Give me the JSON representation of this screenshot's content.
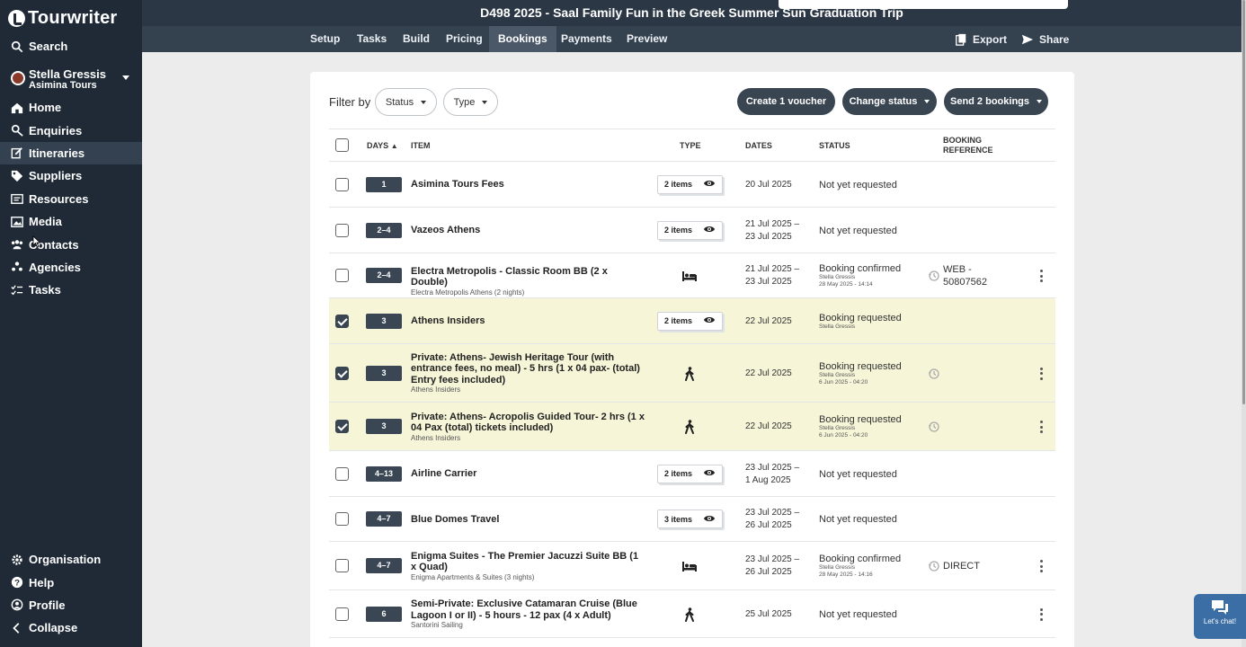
{
  "app": {
    "logo_text": "Tourwriter"
  },
  "sidebar": {
    "search_label": "Search",
    "user": {
      "name": "Stella Gressis",
      "company": "Asimina Tours"
    },
    "nav": [
      {
        "label": "Home",
        "icon": "home-icon"
      },
      {
        "label": "Enquiries",
        "icon": "enquiries-icon"
      },
      {
        "label": "Itineraries",
        "icon": "itineraries-icon",
        "active": true
      },
      {
        "label": "Suppliers",
        "icon": "tag-icon"
      },
      {
        "label": "Resources",
        "icon": "resources-icon"
      },
      {
        "label": "Media",
        "icon": "image-icon"
      },
      {
        "label": "Contacts",
        "icon": "contacts-icon"
      },
      {
        "label": "Agencies",
        "icon": "agencies-icon"
      },
      {
        "label": "Tasks",
        "icon": "tasks-icon"
      }
    ],
    "bottom": [
      {
        "label": "Organisation",
        "icon": "gear-icon"
      },
      {
        "label": "Help",
        "icon": "help-icon"
      },
      {
        "label": "Profile",
        "icon": "profile-icon"
      },
      {
        "label": "Collapse",
        "icon": "chevron-left-icon"
      }
    ]
  },
  "header": {
    "title": "D498 2025 - Saal Family Fun in the Greek Summer Sun Graduation Trip",
    "tabs": [
      "Setup",
      "Tasks",
      "Build",
      "Pricing",
      "Bookings",
      "Payments",
      "Preview"
    ],
    "active_tab": "Bookings",
    "export_label": "Export",
    "share_label": "Share"
  },
  "toolbar": {
    "filter_label": "Filter by",
    "status_filter": "Status",
    "type_filter": "Type",
    "voucher_button": "Create 1 voucher",
    "change_status_button": "Change status",
    "send_button": "Send 2 bookings"
  },
  "table": {
    "columns": {
      "days": "DAYS",
      "item": "ITEM",
      "type": "TYPE",
      "dates": "DATES",
      "status": "STATUS",
      "ref_line1": "BOOKING",
      "ref_line2": "REFERENCE"
    },
    "rows": [
      {
        "days": "1",
        "item": "Asimina Tours Fees",
        "sub": "",
        "type": "items",
        "items_label": "2 items",
        "date1": "20 Jul 2025",
        "date2": "",
        "status": "Not yet requested",
        "status_by": "",
        "status_at": "",
        "ref1": "",
        "ref2": "",
        "checked": false
      },
      {
        "days": "2–4",
        "item": "Vazeos Athens",
        "sub": "",
        "type": "items",
        "items_label": "2 items",
        "date1": "21 Jul 2025 –",
        "date2": "23 Jul 2025",
        "status": "Not yet requested",
        "status_by": "",
        "status_at": "",
        "ref1": "",
        "ref2": "",
        "checked": false
      },
      {
        "days": "2–4",
        "item": "Electra Metropolis - Classic Room BB (2 x Double)",
        "sub": "Electra Metropolis Athens (2 nights)",
        "type": "bed",
        "items_label": "",
        "date1": "21 Jul 2025 –",
        "date2": "23 Jul 2025",
        "status": "Booking confirmed",
        "status_by": "Stella Gressis",
        "status_at": "28 May 2025 - 14:14",
        "ref1": "WEB -",
        "ref2": "50807562",
        "checked": false
      },
      {
        "days": "3",
        "item": "Athens Insiders",
        "sub": "",
        "type": "items",
        "items_label": "2 items",
        "date1": "22 Jul 2025",
        "date2": "",
        "status": "Booking requested",
        "status_by": "Stella Gressis",
        "status_at": "",
        "ref1": "",
        "ref2": "",
        "checked": true
      },
      {
        "days": "3",
        "item": "Private: Athens- Jewish Heritage Tour (with entrance fees, no meal) - 5 hrs (1 x 04 pax- (total) Entry fees included)",
        "sub": "Athens Insiders",
        "type": "walk",
        "items_label": "",
        "date1": "22 Jul 2025",
        "date2": "",
        "status": "Booking requested",
        "status_by": "Stella Gressis",
        "status_at": "6 Jun 2025 - 04:20",
        "ref1": "",
        "ref2": "",
        "checked": true
      },
      {
        "days": "3",
        "item": "Private: Athens- Acropolis Guided Tour- 2 hrs (1 x 04 Pax (total) tickets included)",
        "sub": "Athens Insiders",
        "type": "walk",
        "items_label": "",
        "date1": "22 Jul 2025",
        "date2": "",
        "status": "Booking requested",
        "status_by": "Stella Gressis",
        "status_at": "6 Jun 2025 - 04:20",
        "ref1": "",
        "ref2": "",
        "checked": true
      },
      {
        "days": "4–13",
        "item": "Airline Carrier",
        "sub": "",
        "type": "items",
        "items_label": "2 items",
        "date1": "23 Jul 2025 –",
        "date2": "1 Aug 2025",
        "status": "Not yet requested",
        "status_by": "",
        "status_at": "",
        "ref1": "",
        "ref2": "",
        "checked": false
      },
      {
        "days": "4–7",
        "item": "Blue Domes Travel",
        "sub": "",
        "type": "items",
        "items_label": "3 items",
        "date1": "23 Jul 2025 –",
        "date2": "26 Jul 2025",
        "status": "Not yet requested",
        "status_by": "",
        "status_at": "",
        "ref1": "",
        "ref2": "",
        "checked": false
      },
      {
        "days": "4–7",
        "item": "Enigma Suites - The Premier Jacuzzi Suite BB (1 x Quad)",
        "sub": "Enigma Apartments & Suites (3 nights)",
        "type": "bed",
        "items_label": "",
        "date1": "23 Jul 2025 –",
        "date2": "26 Jul 2025",
        "status": "Booking confirmed",
        "status_by": "Stella Gressis",
        "status_at": "28 May 2025 - 14:16",
        "ref1": "DIRECT",
        "ref2": "",
        "checked": false
      },
      {
        "days": "6",
        "item": "Semi-Private: Exclusive Catamaran Cruise (Blue Lagoon I or II) - 5 hours - 12 pax (4 x Adult)",
        "sub": "Santorini Sailing",
        "type": "walk",
        "items_label": "",
        "date1": "25 Jul 2025",
        "date2": "",
        "status": "Not yet requested",
        "status_by": "",
        "status_at": "",
        "ref1": "",
        "ref2": "",
        "checked": false
      }
    ]
  },
  "chat": {
    "label": "Let's chat!"
  },
  "colors": {
    "sidebar": "#1f2a36",
    "topbar": "#2b3745",
    "tabbar": "#34414f",
    "selected_row": "#f6f5d8",
    "days_badge": "#3b4654",
    "chat": "#3a6ea5"
  }
}
